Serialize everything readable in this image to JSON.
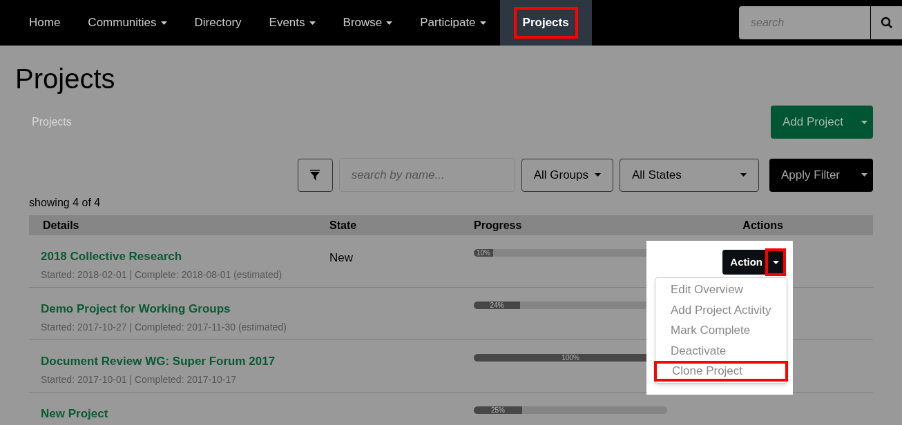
{
  "navbar": {
    "items": [
      {
        "label": "Home",
        "has_caret": false,
        "selected": false
      },
      {
        "label": "Communities",
        "has_caret": true,
        "selected": false
      },
      {
        "label": "Directory",
        "has_caret": false,
        "selected": false
      },
      {
        "label": "Events",
        "has_caret": true,
        "selected": false
      },
      {
        "label": "Browse",
        "has_caret": true,
        "selected": false
      },
      {
        "label": "Participate",
        "has_caret": true,
        "selected": false
      },
      {
        "label": "Projects",
        "has_caret": false,
        "selected": true
      }
    ],
    "search": {
      "placeholder": "search"
    }
  },
  "page": {
    "title": "Projects",
    "breadcrumb": "Projects",
    "add_button": "Add Project"
  },
  "filters": {
    "search": {
      "placeholder": "search by name..."
    },
    "groups": "All Groups",
    "states": "All States",
    "apply": "Apply Filter"
  },
  "count": "showing 4 of 4",
  "table": {
    "columns": [
      "Details",
      "State",
      "Progress",
      "Actions"
    ],
    "rows": [
      {
        "title": "2018 Collective Research",
        "dates": "Started: 2018-02-01 | Complete: 2018-08-01 (estimated)",
        "state": "New",
        "level": 0.1,
        "reading": "10%"
      },
      {
        "title": "Demo Project for Working Groups",
        "dates": "Started: 2017-10-27 | Completed: 2017-11-30 (estimated)",
        "state": "",
        "level": 0.24,
        "reading": "24%"
      },
      {
        "title": "Document Review WG: Super Forum 2017",
        "dates": "Started: 2017-10-01 | Completed: 2017-10-17",
        "state": "",
        "level": 1,
        "reading": "100%"
      },
      {
        "title": "New Project",
        "dates": "",
        "state": "",
        "level": 0.25,
        "reading": "25%"
      }
    ]
  },
  "action_menu": {
    "button": "Action",
    "items": [
      {
        "label": "Edit Overview",
        "highlighted": false
      },
      {
        "label": "Add Project Activity",
        "highlighted": false
      },
      {
        "label": "Mark Complete",
        "highlighted": false
      },
      {
        "label": "Deactivate",
        "highlighted": false
      },
      {
        "label": "Clone Project",
        "highlighted": true
      }
    ]
  }
}
